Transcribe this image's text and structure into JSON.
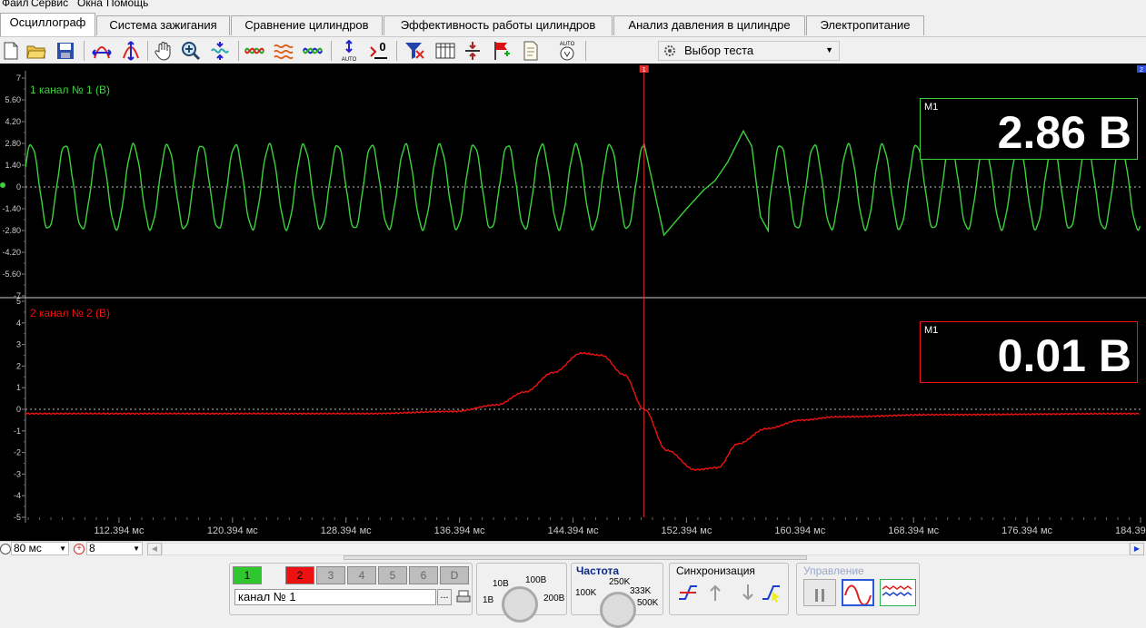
{
  "menu": [
    "Файл",
    "Сервис",
    "Окна",
    "Помощь"
  ],
  "tabs": [
    {
      "label": "Осциллограф",
      "active": true
    },
    {
      "label": "Система зажигания",
      "active": false
    },
    {
      "label": "Сравнение цилиндров",
      "active": false
    },
    {
      "label": "Эффективность работы цилиндров",
      "active": false
    },
    {
      "label": "Анализ давления в цилиндре",
      "active": false
    },
    {
      "label": "Электропитание",
      "active": false
    }
  ],
  "toolbar": {
    "icons": [
      "new-file-icon",
      "open-folder-icon",
      "save-icon",
      "cursor-range-icon",
      "scale-icon",
      "pan-hand-icon",
      "zoom-icon",
      "fit-icon",
      "wave-compare-icon",
      "wave-stack-icon",
      "wave-overlay-icon",
      "auto-scale-icon",
      "zero-offset-icon",
      "filter-icon",
      "table-icon",
      "split-icon",
      "marker-flag-icon",
      "document-icon",
      "auto-voltage-icon"
    ],
    "auto_label": "AUTO",
    "zero_label": "0",
    "test_select": "Выбор теста"
  },
  "channels": [
    {
      "id": 1,
      "label": "1  канал № 1 (В)",
      "color": "#3cd23c",
      "yticks": [
        "7",
        "5.60",
        "4.20",
        "2.80",
        "1.40",
        "0",
        "-1.40",
        "-2.80",
        "-4.20",
        "-5.60",
        "-7"
      ],
      "ylim": [
        -7,
        7
      ],
      "measure": {
        "name": "M1",
        "value": "2.86 В"
      }
    },
    {
      "id": 2,
      "label": "2  канал № 2 (В)",
      "color": "#ee1111",
      "yticks": [
        "5",
        "4",
        "3",
        "2",
        "1",
        "0",
        "-1",
        "-2",
        "-3",
        "-4",
        "-5"
      ],
      "ylim": [
        -5,
        5
      ],
      "measure": {
        "name": "M1",
        "value": "0.01 В"
      }
    }
  ],
  "chart_data": {
    "type": "line",
    "x_unit": "мс",
    "xlim": [
      105.8,
      184.394
    ],
    "xticks": [
      "112.394 мс",
      "120.394 мс",
      "128.394 мс",
      "136.394 мс",
      "144.394 мс",
      "152.394 мс",
      "160.394 мс",
      "168.394 мс",
      "176.394 мс",
      "184.394 мс"
    ],
    "cursor_x": 149.4,
    "cursor_label": "1",
    "cursor2_label": "2",
    "series": [
      {
        "name": "канал № 1 (В)",
        "period_ms": 2.4,
        "amplitude": 2.7,
        "disturbance": [
          [
            149.4,
            2.8
          ],
          [
            150.8,
            -3.1
          ],
          [
            152.4,
            -1.4
          ],
          [
            153.6,
            -0.2
          ],
          [
            154.4,
            0.4
          ],
          [
            155.3,
            1.6
          ],
          [
            156.4,
            3.6
          ],
          [
            157.0,
            2.6
          ],
          [
            157.6,
            -1.9
          ],
          [
            158.2,
            -2.9
          ]
        ],
        "points": [
          [
            149.4,
            2.8
          ],
          [
            150.8,
            -3.1
          ],
          [
            152.4,
            -1.4
          ],
          [
            153.6,
            -0.2
          ],
          [
            154.4,
            0.4
          ],
          [
            155.3,
            1.6
          ],
          [
            156.4,
            3.6
          ]
        ]
      },
      {
        "name": "канал № 2 (В)",
        "points": [
          [
            105.8,
            -0.2
          ],
          [
            130.0,
            -0.2
          ],
          [
            136.0,
            -0.1
          ],
          [
            139.0,
            0.2
          ],
          [
            141.0,
            0.8
          ],
          [
            143.0,
            1.7
          ],
          [
            145.0,
            2.6
          ],
          [
            146.4,
            2.5
          ],
          [
            148.0,
            1.6
          ],
          [
            149.4,
            0.0
          ],
          [
            151.0,
            -1.9
          ],
          [
            153.0,
            -2.8
          ],
          [
            154.6,
            -2.7
          ],
          [
            156.0,
            -1.6
          ],
          [
            158.0,
            -0.9
          ],
          [
            160.5,
            -0.5
          ],
          [
            163.0,
            -0.35
          ],
          [
            170.0,
            -0.25
          ],
          [
            184.394,
            -0.2
          ]
        ]
      }
    ]
  },
  "statusbar": {
    "timebase": "80 мс",
    "count": "8"
  },
  "bottom": {
    "channel_buttons": [
      "1",
      "2",
      "3",
      "4",
      "5",
      "6",
      "D"
    ],
    "channel_name": "канал № 1",
    "more": "...",
    "range_labels": [
      "10В",
      "100В",
      "1В",
      "200В"
    ],
    "freq_title": "Частота",
    "freq_labels": [
      "250K",
      "100K",
      "333K",
      "500K"
    ],
    "sync_title": "Синхронизация",
    "control_title": "Управление"
  }
}
